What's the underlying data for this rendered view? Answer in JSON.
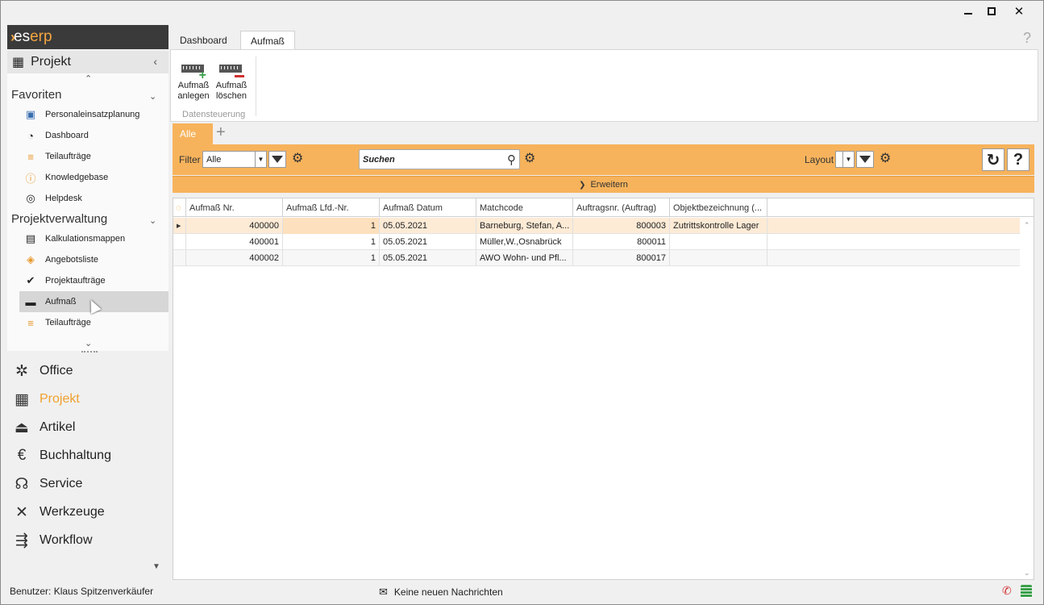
{
  "app": {
    "logo_mark": "›",
    "logo_prefix": "es",
    "logo_suffix": "erp"
  },
  "nav": {
    "header": "Projekt",
    "sections": [
      {
        "title": "Favoriten",
        "items": [
          {
            "label": "Personaleinsatzplanung",
            "icon": "personnel-icon"
          },
          {
            "label": "Dashboard",
            "icon": "gauge-icon"
          },
          {
            "label": "Teilaufträge",
            "icon": "layers-icon"
          },
          {
            "label": "Knowledgebase",
            "icon": "info-icon"
          },
          {
            "label": "Helpdesk",
            "icon": "lifebuoy-icon"
          }
        ]
      },
      {
        "title": "Projektverwaltung",
        "items": [
          {
            "label": "Kalkulationsmappen",
            "icon": "calculator-icon"
          },
          {
            "label": "Angebotsliste",
            "icon": "tag-icon"
          },
          {
            "label": "Projektaufträge",
            "icon": "check-circle-icon"
          },
          {
            "label": "Aufmaß",
            "icon": "ruler-icon",
            "selected": true
          },
          {
            "label": "Teilaufträge",
            "icon": "layers-icon"
          }
        ]
      }
    ],
    "modules": [
      {
        "label": "Office",
        "icon": "wheel-icon"
      },
      {
        "label": "Projekt",
        "icon": "project-icon",
        "active": true
      },
      {
        "label": "Artikel",
        "icon": "siren-icon"
      },
      {
        "label": "Buchhaltung",
        "icon": "euro-icon"
      },
      {
        "label": "Service",
        "icon": "headset-icon"
      },
      {
        "label": "Werkzeuge",
        "icon": "tools-icon"
      },
      {
        "label": "Workflow",
        "icon": "workflow-icon"
      }
    ]
  },
  "tabs": [
    {
      "label": "Dashboard",
      "active": false
    },
    {
      "label": "Aufmaß",
      "active": true
    }
  ],
  "ribbon": {
    "buttons": [
      {
        "line1": "Aufmaß",
        "line2": "anlegen"
      },
      {
        "line1": "Aufmaß",
        "line2": "löschen"
      }
    ],
    "group_label": "Datensteuerung"
  },
  "views": {
    "active_tab": "Alle"
  },
  "filterbar": {
    "filter_label": "Filter",
    "filter_value": "Alle",
    "search_placeholder": "Suchen",
    "layout_label": "Layout",
    "layout_value": "",
    "expand_label": "Erweitern"
  },
  "grid": {
    "columns": [
      "Aufmaß Nr.",
      "Aufmaß Lfd.-Nr.",
      "Aufmaß Datum",
      "Matchcode",
      "Auftragsnr. (Auftrag)",
      "Objektbezeichnung (..."
    ],
    "rows": [
      {
        "nr": "400000",
        "lfd": "1",
        "datum": "05.05.2021",
        "matchcode": "Barneburg, Stefan, A...",
        "auftrag": "800003",
        "objekt": "Zutrittskontrolle Lager"
      },
      {
        "nr": "400001",
        "lfd": "1",
        "datum": "05.05.2021",
        "matchcode": "Müller,W.,Osnabrück",
        "auftrag": "800011",
        "objekt": ""
      },
      {
        "nr": "400002",
        "lfd": "1",
        "datum": "05.05.2021",
        "matchcode": "AWO Wohn- und Pfl...",
        "auftrag": "800017",
        "objekt": ""
      }
    ]
  },
  "status": {
    "user": "Benutzer: Klaus Spitzenverkäufer",
    "messages": "Keine neuen Nachrichten"
  },
  "colors": {
    "accent": "#f7b35c",
    "active_module": "#f0a030"
  }
}
